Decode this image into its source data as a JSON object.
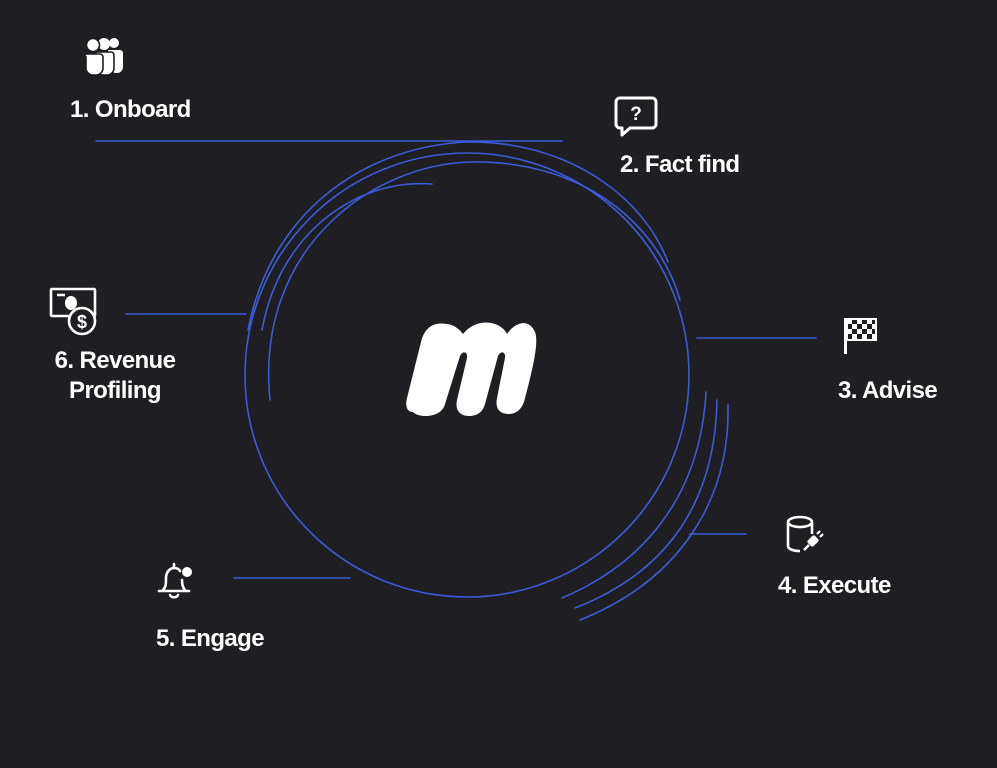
{
  "logo": {
    "letter": "m",
    "name": "m-logo-icon"
  },
  "colors": {
    "background": "#1f1e22",
    "accent": "#3d5bd9",
    "text": "#ffffff"
  },
  "steps": [
    {
      "label": "1. Onboard",
      "icon": "users-icon"
    },
    {
      "label": "2. Fact find",
      "icon": "question-chat-icon"
    },
    {
      "label": "3. Advise",
      "icon": "checkered-flag-icon"
    },
    {
      "label": "4. Execute",
      "icon": "database-plug-icon"
    },
    {
      "label": "5. Engage",
      "icon": "notification-bell-icon"
    },
    {
      "label_line1": "6. Revenue",
      "label_line2": "Profiling",
      "icon": "money-dollar-icon"
    }
  ]
}
